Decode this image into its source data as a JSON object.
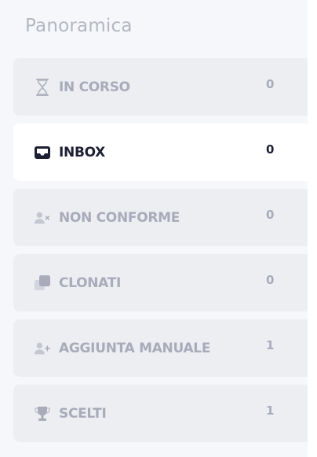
{
  "sidebar": {
    "title": "Panoramica",
    "items": [
      {
        "label": "IN CORSO",
        "count": "0",
        "icon": "hourglass-icon",
        "active": false
      },
      {
        "label": "INBOX",
        "count": "0",
        "icon": "inbox-icon",
        "active": true
      },
      {
        "label": "NON CONFORME",
        "count": "0",
        "icon": "user-x-icon",
        "active": false
      },
      {
        "label": "CLONATI",
        "count": "0",
        "icon": "copy-icon",
        "active": false
      },
      {
        "label": "AGGIUNTA MANUALE",
        "count": "1",
        "icon": "user-plus-icon",
        "active": false
      },
      {
        "label": "SCELTI",
        "count": "1",
        "icon": "trophy-icon",
        "active": false
      }
    ]
  },
  "colors": {
    "background": "#f5f7fa",
    "item_background": "#eceef2",
    "active_item_background": "#ffffff",
    "muted_text": "#a9abba",
    "active_text": "#1d2033"
  }
}
